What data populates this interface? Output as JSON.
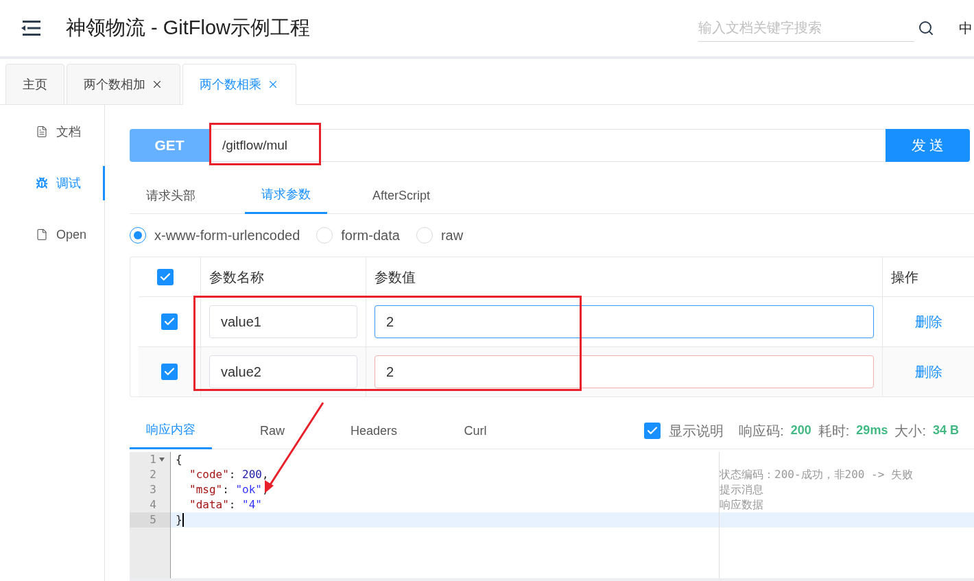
{
  "header": {
    "title": "神领物流 - GitFlow示例工程",
    "search": {
      "placeholder": "输入文档关键字搜索"
    },
    "language": "中"
  },
  "tabs": [
    {
      "label": "主页",
      "selected": false,
      "closable": false
    },
    {
      "label": "两个数相加",
      "selected": false,
      "closable": true
    },
    {
      "label": "两个数相乘",
      "selected": true,
      "closable": true
    }
  ],
  "sidebar": [
    {
      "label": "文档",
      "selected": false
    },
    {
      "label": "调试",
      "selected": true
    },
    {
      "label": "Open",
      "selected": false
    }
  ],
  "request": {
    "method": "GET",
    "url": "/gitflow/mul",
    "send": "发 送"
  },
  "request_tabs": [
    {
      "label": "请求头部",
      "selected": false
    },
    {
      "label": "请求参数",
      "selected": true
    },
    {
      "label": "AfterScript",
      "selected": false
    }
  ],
  "body_types": [
    {
      "label": "x-www-form-urlencoded",
      "selected": true
    },
    {
      "label": "form-data",
      "selected": false
    },
    {
      "label": "raw",
      "selected": false
    }
  ],
  "params": {
    "columns": [
      "参数名称",
      "参数值",
      "操作"
    ],
    "all_checked": true,
    "rows": [
      {
        "checked": true,
        "name": "value1",
        "value": "2",
        "focused": true,
        "invalid": false,
        "action": "删除"
      },
      {
        "checked": true,
        "name": "value2",
        "value": "2",
        "focused": false,
        "invalid": true,
        "action": "删除"
      }
    ]
  },
  "response_tabs": [
    {
      "label": "响应内容",
      "selected": true
    },
    {
      "label": "Raw",
      "selected": false
    },
    {
      "label": "Headers",
      "selected": false
    },
    {
      "label": "Curl",
      "selected": false
    }
  ],
  "show_notes": {
    "label": "显示说明",
    "checked": true
  },
  "stats": [
    {
      "label": "响应码:",
      "value": "200"
    },
    {
      "label": "耗时:",
      "value": "29ms"
    },
    {
      "label": "大小:",
      "value": "34 B"
    }
  ],
  "code_lines": [
    {
      "number": "1",
      "foldable": true,
      "current": false,
      "indented": false,
      "tokens": [
        {
          "kind": "punct",
          "text": "{"
        }
      ]
    },
    {
      "number": "2",
      "foldable": false,
      "current": false,
      "indented": true,
      "note": "状态编码：200-成功，非200 -> 失败",
      "tokens": [
        {
          "kind": "key",
          "text": "\"code\""
        },
        {
          "kind": "punct",
          "text": ": "
        },
        {
          "kind": "number",
          "text": "200"
        },
        {
          "kind": "punct",
          "text": ","
        }
      ]
    },
    {
      "number": "3",
      "foldable": false,
      "current": false,
      "indented": true,
      "note": "提示消息",
      "tokens": [
        {
          "kind": "key",
          "text": "\"msg\""
        },
        {
          "kind": "punct",
          "text": ": "
        },
        {
          "kind": "string",
          "text": "\"ok\""
        },
        {
          "kind": "punct",
          "text": ","
        }
      ]
    },
    {
      "number": "4",
      "foldable": false,
      "current": false,
      "indented": true,
      "note": "响应数据",
      "tokens": [
        {
          "kind": "key",
          "text": "\"data\""
        },
        {
          "kind": "punct",
          "text": ": "
        },
        {
          "kind": "string",
          "text": "\"4\""
        }
      ]
    },
    {
      "number": "5",
      "foldable": false,
      "current": true,
      "indented": false,
      "tokens": [
        {
          "kind": "punct",
          "text": "}"
        }
      ]
    }
  ]
}
